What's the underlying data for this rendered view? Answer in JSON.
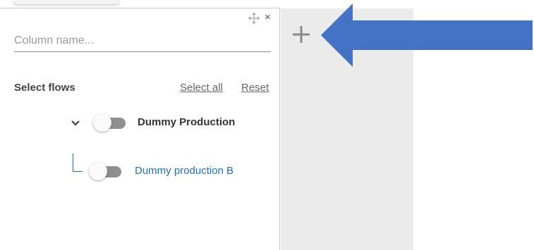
{
  "panel": {
    "column_name_placeholder": "Column name...",
    "move_icon": "move-icon",
    "close_glyph": "×"
  },
  "flows": {
    "title": "Select flows",
    "select_all_label": "Select all",
    "reset_label": "Reset",
    "items": [
      {
        "label": "Dummy Production",
        "enabled": false,
        "expanded": true,
        "level": 0
      },
      {
        "label": "Dummy production B",
        "enabled": false,
        "level": 1
      }
    ]
  },
  "add_column": {
    "icon": "plus-icon"
  },
  "annotation": {
    "icon": "arrow-left-icon",
    "color": "#4472c4"
  },
  "colors": {
    "link_blue": "#1f6fb4",
    "toggle_off": "#8f8f8f",
    "add_column_background": "#ebebeb"
  }
}
